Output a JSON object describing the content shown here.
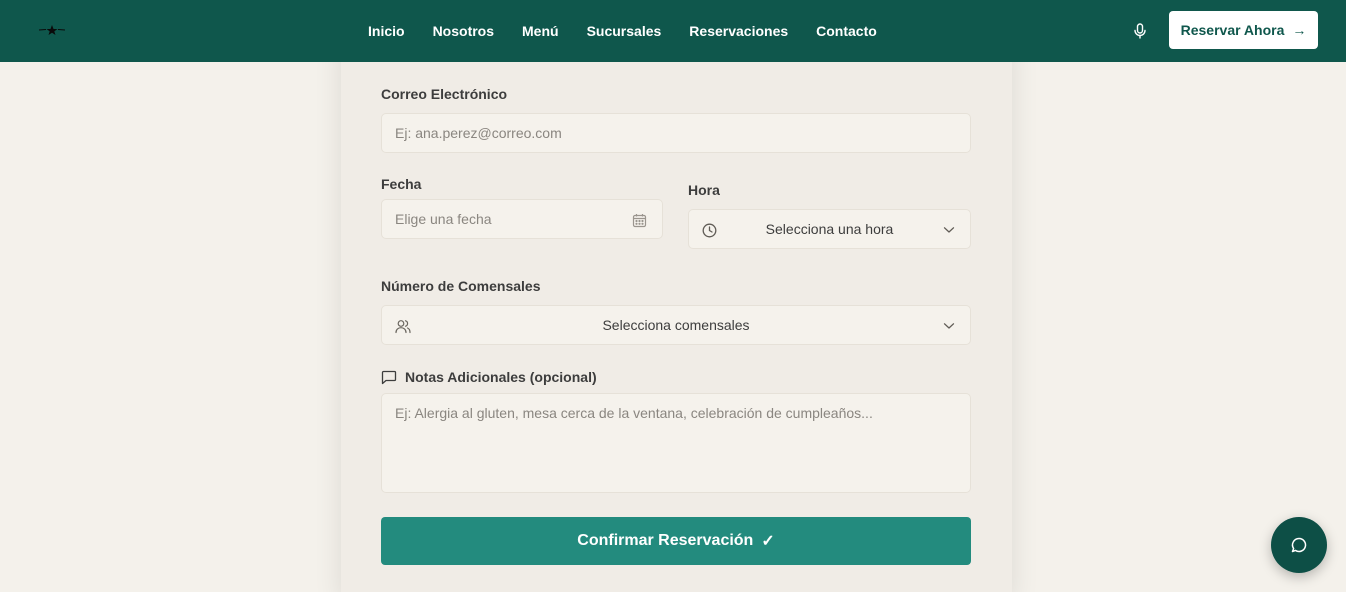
{
  "nav": {
    "links": [
      "Inicio",
      "Nosotros",
      "Menú",
      "Sucursales",
      "Reservaciones",
      "Contacto"
    ],
    "cta_label": "Reservar Ahora",
    "cta_arrow": "→"
  },
  "form": {
    "email": {
      "label": "Correo Electrónico",
      "placeholder": "Ej: ana.perez@correo.com"
    },
    "date": {
      "label": "Fecha",
      "placeholder": "Elige una fecha"
    },
    "time": {
      "label": "Hora",
      "value": "Selecciona una hora"
    },
    "guests": {
      "label": "Número de Comensales",
      "value": "Selecciona comensales"
    },
    "notes": {
      "label": "Notas Adicionales (opcional)",
      "placeholder": "Ej: Alergia al gluten, mesa cerca de la ventana, celebración de cumpleaños..."
    },
    "submit_label": "Confirmar Reservación",
    "submit_check": "✓"
  },
  "colors": {
    "primary": "#0f574c",
    "button": "#238b7e",
    "background": "#f4f1eb"
  },
  "icons": [
    "logo-icon",
    "microphone-icon",
    "calendar-icon",
    "clock-icon",
    "chevron-down-icon",
    "users-icon",
    "message-icon",
    "chat-icon"
  ]
}
